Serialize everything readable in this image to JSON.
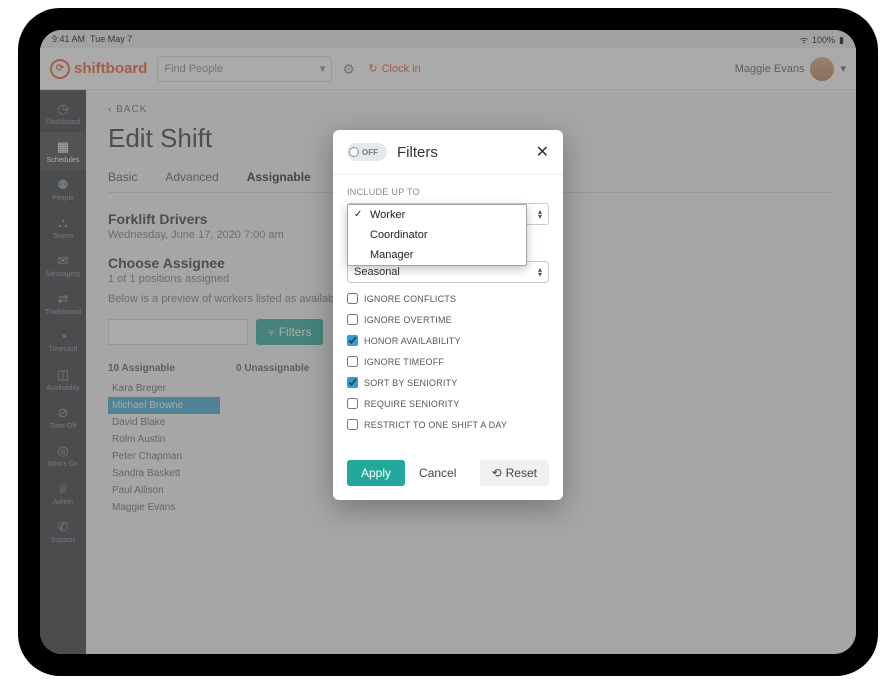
{
  "status": {
    "time": "9:41 AM",
    "date": "Tue May 7",
    "wifi": "100%"
  },
  "brand": "shiftboard",
  "search": {
    "placeholder": "Find People"
  },
  "clockin": "Clock in",
  "username": "Maggie Evans",
  "sidebar": {
    "items": [
      {
        "label": "Dashboard"
      },
      {
        "label": "Schedules"
      },
      {
        "label": "People"
      },
      {
        "label": "Teams"
      },
      {
        "label": "Messaging"
      },
      {
        "label": "Tradeboard"
      },
      {
        "label": "Timecard"
      },
      {
        "label": "Availability"
      },
      {
        "label": "Time Off"
      },
      {
        "label": "Who's On"
      },
      {
        "label": "Admin"
      },
      {
        "label": "Support"
      }
    ]
  },
  "back": "‹ BACK",
  "page_title": "Edit Shift",
  "tabs": [
    "Basic",
    "Advanced",
    "Assignable"
  ],
  "section": {
    "team": "Forklift Drivers",
    "dt": "Wednesday, June 17, 2020 7:00 am",
    "choose": "Choose Assignee",
    "positions": "1 of 1 positions assigned",
    "preview": "Below is a preview of workers listed as available during. Choose worker(s) to assign below."
  },
  "filters_btn": "Filters",
  "lists": {
    "assignable_h": "10 Assignable",
    "unassignable_h": "0 Unassignable",
    "assignable": [
      "Kara Breger",
      "Michael Browne",
      "David Blake",
      "Rolm Austin",
      "Peter Chapman",
      "Sandra Baskett",
      "Paul Allison",
      "Maggie Evans"
    ]
  },
  "modal": {
    "off": "OFF",
    "title": "Filters",
    "include_label": "INCLUDE UP TO",
    "select2": "Seasonal",
    "checks": [
      {
        "label": "IGNORE CONFLICTS",
        "checked": false
      },
      {
        "label": "IGNORE OVERTIME",
        "checked": false
      },
      {
        "label": "HONOR AVAILABILITY",
        "checked": true
      },
      {
        "label": "IGNORE TIMEOFF",
        "checked": false
      },
      {
        "label": "SORT BY SENIORITY",
        "checked": true
      },
      {
        "label": "REQUIRE SENIORITY",
        "checked": false
      },
      {
        "label": "RESTRICT TO ONE SHIFT A DAY",
        "checked": false
      }
    ],
    "apply": "Apply",
    "cancel": "Cancel",
    "reset": "Reset"
  },
  "dropdown": {
    "options": [
      "Worker",
      "Coordinator",
      "Manager"
    ],
    "selected": "Worker"
  }
}
